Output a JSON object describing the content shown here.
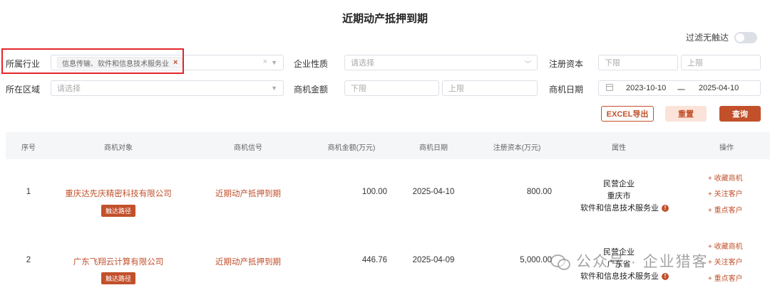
{
  "page": {
    "title": "近期动产抵押到期"
  },
  "filter_toggle": {
    "label": "过滤无触达"
  },
  "filters": {
    "industry": {
      "label": "所属行业",
      "tag": "信息传输、软件和信息技术服务业"
    },
    "nature": {
      "label": "企业性质",
      "placeholder": "请选择"
    },
    "capital": {
      "label": "注册资本",
      "min_placeholder": "下限",
      "max_placeholder": "上限"
    },
    "region": {
      "label": "所在区域",
      "placeholder": "请选择"
    },
    "amount": {
      "label": "商机金额",
      "min_placeholder": "下限",
      "max_placeholder": "上限"
    },
    "date": {
      "label": "商机日期",
      "start": "2023-10-10",
      "separator": "一",
      "end": "2025-04-10"
    }
  },
  "buttons": {
    "excel": "EXCEL导出",
    "reset": "重置",
    "query": "查询"
  },
  "table": {
    "headers": [
      "序号",
      "商机对象",
      "商机信号",
      "商机金额(万元)",
      "商机日期",
      "注册资本(万元)",
      "属性",
      "操作"
    ],
    "rows": [
      {
        "index": "1",
        "company": "重庆达先庆精密科技有限公司",
        "badge": "触达路径",
        "signal": "近期动产抵押到期",
        "amount": "100.00",
        "date": "2025-04-10",
        "capital": "800.00",
        "attr_type": "民营企业",
        "attr_region": "重庆市",
        "attr_industry": "软件和信息技术服务业",
        "ops": [
          "+ 收藏商机",
          "+ 关注客户",
          "+ 重点客户"
        ]
      },
      {
        "index": "2",
        "company": "广东飞翔云计算有限公司",
        "badge": "触达路径",
        "signal": "近期动产抵押到期",
        "amount": "446.76",
        "date": "2025-04-09",
        "capital": "5,000.00",
        "attr_type": "民营企业",
        "attr_region": "广东省",
        "attr_industry": "软件和信息技术服务业",
        "ops": [
          "+ 收藏商机",
          "+ 关注客户",
          "+ 重点客户"
        ]
      }
    ]
  },
  "watermark": {
    "text": "公众号 · 企业猎客"
  }
}
